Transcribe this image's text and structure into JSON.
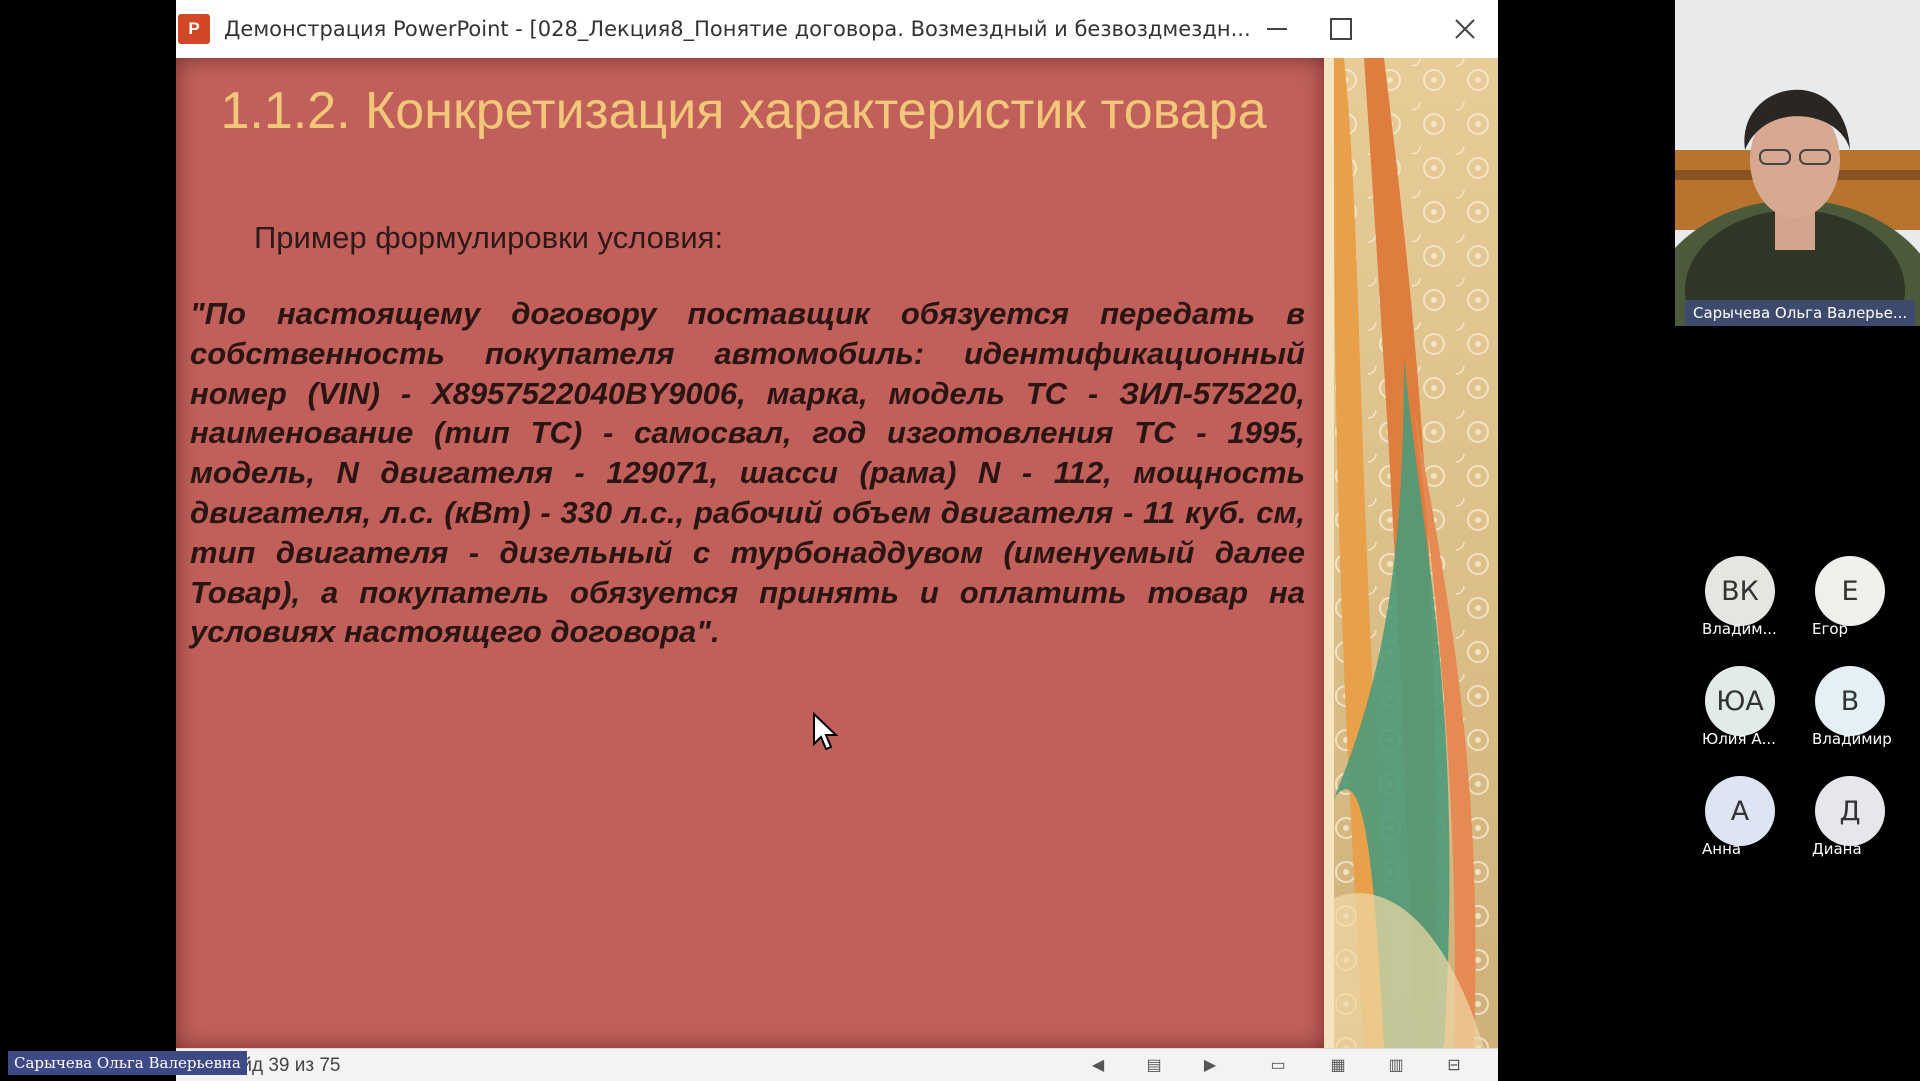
{
  "window": {
    "app_icon": "P",
    "title": "Демонстрация PowerPoint - [028_Лекция8_Понятие договора. Возмездный и безвоздмездн..."
  },
  "slide": {
    "title": "1.1.2. Конкретизация характеристик товара",
    "subtitle": "Пример формулировки условия:",
    "body": "\"По настоящему договору поставщик обязуется передать в собственность покупателя автомобиль: идентификационный номер (VIN) - X8957522040BY9006, марка, модель ТС - ЗИЛ-575220, наименование (тип ТС) - самосвал, год изготовления ТС - 1995, модель, N двигателя - 129071, шасси (рама) N - 112, мощность двигателя, л.с. (кВт) - 330 л.с., рабочий объем двигателя - 11 куб. см, тип двигателя - дизельный с турбонаддувом (именуемый далее Товар), а покупатель обязуется принять и оплатить товар на условиях настоящего договора\".",
    "colors": {
      "background": "#c1605a",
      "title": "#f3c77a",
      "text": "#2a1512"
    }
  },
  "statusbar": {
    "slide_counter": "Слайд 39 из 75",
    "icons": [
      "previous-icon",
      "notes-icon",
      "next-icon",
      "normal-view-icon",
      "slide-sorter-icon",
      "reading-view-icon",
      "slideshow-icon"
    ]
  },
  "speaker": {
    "name": "Сарычева Ольга Валерьевна"
  },
  "self_video": {
    "label": "Сарычева Ольга Валерье..."
  },
  "participants": [
    {
      "initials": "ВК",
      "name": "Владим...",
      "color": "#e4e6e2"
    },
    {
      "initials": "Е",
      "name": "Егор",
      "color": "#eef0ec"
    },
    {
      "initials": "ЮА",
      "name": "Юлия А...",
      "color": "#e2ece6"
    },
    {
      "initials": "В",
      "name": "Владимир",
      "color": "#e4f0f4"
    },
    {
      "initials": "А",
      "name": "Анна",
      "color": "#dde4f4"
    },
    {
      "initials": "Д",
      "name": "Диана",
      "color": "#e6e7ea"
    }
  ]
}
